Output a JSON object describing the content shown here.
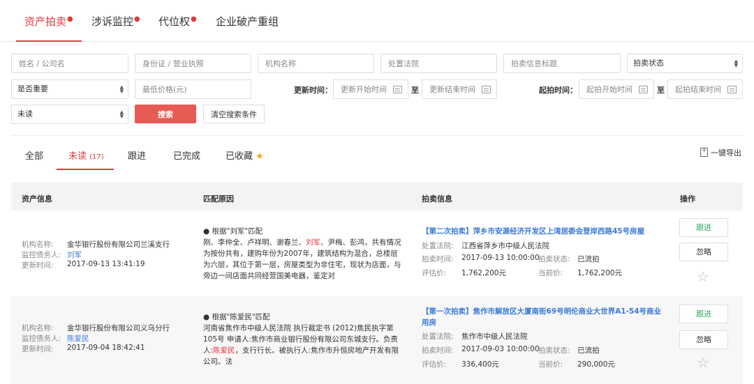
{
  "top_tabs": [
    {
      "label": "资产拍卖",
      "dot": "●"
    },
    {
      "label": "涉诉监控",
      "dot": "●"
    },
    {
      "label": "代位权",
      "dot": "●"
    },
    {
      "label": "企业破产重组",
      "dot": ""
    }
  ],
  "filters": {
    "name_placeholder": "姓名 / 公司名",
    "id_placeholder": "身份证 / 营业执照",
    "org_placeholder": "机构名称",
    "court_placeholder": "处置法院",
    "title_placeholder": "拍卖信息标题",
    "status_select": "拍卖状态",
    "important_select": "是否重要",
    "min_price_placeholder": "最低价格(元)",
    "update_time_label": "更新时间：",
    "update_start_placeholder": "更新开始时间",
    "to1": "至",
    "update_end_placeholder": "更新结束时间",
    "start_time_label": "起拍时间：",
    "start_begin_placeholder": "起拍开始时间",
    "to2": "至",
    "start_end_placeholder": "起拍结束时间",
    "read_select": "未读",
    "search_button": "搜索",
    "clear_button": "清空搜索条件"
  },
  "sub_tabs": {
    "all": "全部",
    "unread": "未读",
    "unread_count": "(17)",
    "follow": "跟进",
    "done": "已完成",
    "favorited": "已收藏",
    "favorited_star": "★",
    "export": "一键导出"
  },
  "table": {
    "headers": [
      "资产信息",
      "匹配原因",
      "拍卖信息",
      "操作"
    ],
    "rows": [
      {
        "org_label": "机构名称:",
        "org": "金华银行股份有限公司兰溪支行",
        "debtor_label": "监控债务人:",
        "debtor": "刘军",
        "updated_label": "更新时间:",
        "updated": "2017-09-13 13:41:19",
        "reason_title": "● 根据\"刘军\"匹配",
        "reason_before": "刚、李仲全、卢祥明、谢春兰、",
        "reason_hl": "刘军",
        "reason_after": "、尹梅、彭鸿，共有情况为按份共有，建购年份为2007年，建筑结构为混合，总楼层为六层，其位于第一层，房屋类型为非住宅，现状为店面，与旁边一间店面共同经营国美电器，鉴定对",
        "auction_title": "【第二次拍卖】萍乡市安源经济开发区上湾居委会登岸西路45号房屋",
        "court_label": "处置法院:",
        "court": "江西省萍乡市中级人民法院",
        "time_label": "拍卖时间:",
        "time": "2017-09-13 10:00:00",
        "status_label": "拍卖状态:",
        "status": "已流拍",
        "eval_label": "评估价:",
        "eval": "1,762,200元",
        "current_label": "当前价:",
        "current": "1,762,200元",
        "follow": "跟进",
        "ignore": "忽略",
        "star": "☆"
      },
      {
        "org_label": "机构名称:",
        "org": "金华银行股份有限公司义乌分行",
        "debtor_label": "监控债务人:",
        "debtor": "陈爱民",
        "updated_label": "更新时间:",
        "updated": "2017-09-04 18:42:41",
        "reason_title": "● 根据\"陈爱民\"匹配",
        "reason_before": "河南省焦作市中级人民法院 执行裁定书 (2012)焦民执字第105号 申请人:焦作市商业银行股份有限公司东城支行。负责人:",
        "reason_hl": "陈爱民",
        "reason_after": "，支行行长。被执行人:焦作市升恒房地产开发有限公司。法",
        "auction_title": "【第一次拍卖】焦作市解放区大厦南街69号明伦商业大世界A1-54号商业用房",
        "court_label": "处置法院:",
        "court": "焦作市中级人民法院",
        "time_label": "拍卖时间:",
        "time": "2017-09-03 10:00:00",
        "status_label": "拍卖状态:",
        "status": "已流拍",
        "eval_label": "评估价:",
        "eval": "336,400元",
        "current_label": "当前价:",
        "current": "290,000元",
        "follow": "跟进",
        "ignore": "忽略",
        "star": "☆"
      }
    ]
  }
}
